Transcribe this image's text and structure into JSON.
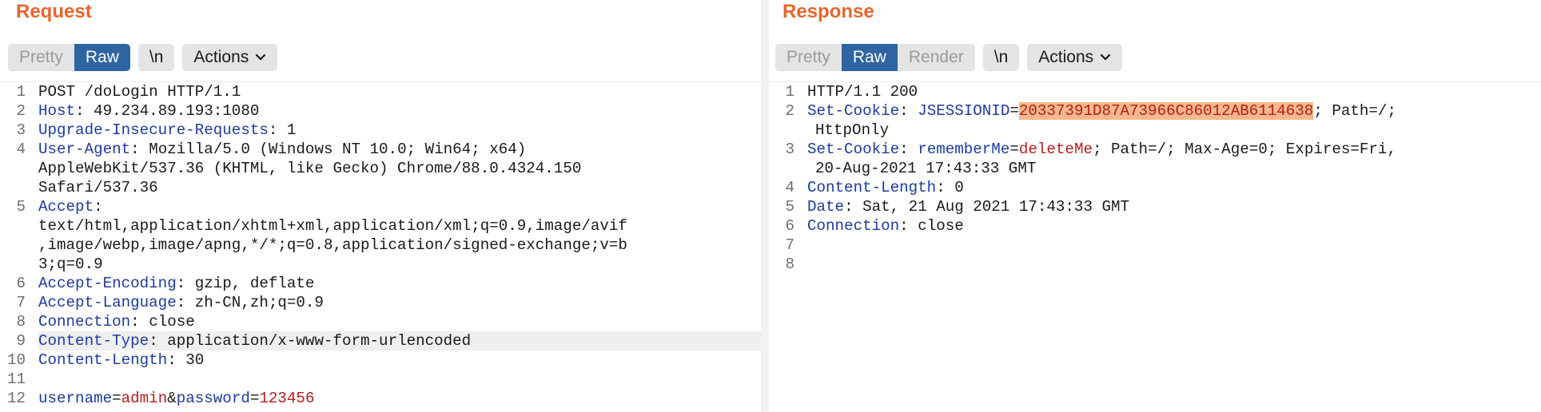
{
  "request": {
    "title": "Request",
    "tabs": [
      {
        "label": "Pretty",
        "active": false
      },
      {
        "label": "Raw",
        "active": true
      }
    ],
    "newline_label": "\\n",
    "actions_label": "Actions",
    "lines": [
      {
        "n": "1",
        "text": "POST /doLogin HTTP/1.1"
      },
      {
        "n": "2",
        "name": "Host",
        "value": "49.234.89.193:1080"
      },
      {
        "n": "3",
        "name": "Upgrade-Insecure-Requests",
        "value": "1"
      },
      {
        "n": "4",
        "name": "User-Agent",
        "value": "Mozilla/5.0 (Windows NT 10.0; Win64; x64)",
        "cont": [
          "AppleWebKit/537.36 (KHTML, like Gecko) Chrome/88.0.4324.150",
          "Safari/537.36"
        ]
      },
      {
        "n": "5",
        "name": "Accept",
        "value": "",
        "cont": [
          "text/html,application/xhtml+xml,application/xml;q=0.9,image/avif",
          ",image/webp,image/apng,*/*;q=0.8,application/signed-exchange;v=b",
          "3;q=0.9"
        ]
      },
      {
        "n": "6",
        "name": "Accept-Encoding",
        "value": "gzip, deflate"
      },
      {
        "n": "7",
        "name": "Accept-Language",
        "value": "zh-CN,zh;q=0.9"
      },
      {
        "n": "8",
        "name": "Connection",
        "value": "close"
      },
      {
        "n": "9",
        "name": "Content-Type",
        "value": "application/x-www-form-urlencoded"
      },
      {
        "n": "10",
        "name": "Content-Length",
        "value": "30"
      },
      {
        "n": "11",
        "text": ""
      },
      {
        "n": "12",
        "params": [
          {
            "k": "username",
            "v": "admin"
          },
          {
            "k": "password",
            "v": "123456"
          }
        ]
      }
    ]
  },
  "response": {
    "title": "Response",
    "tabs": [
      {
        "label": "Pretty",
        "active": false
      },
      {
        "label": "Raw",
        "active": true
      },
      {
        "label": "Render",
        "active": false
      }
    ],
    "newline_label": "\\n",
    "actions_label": "Actions",
    "line_numbers": [
      "1",
      "2",
      "3",
      "4",
      "5",
      "6",
      "7",
      "8"
    ],
    "status_line": "HTTP/1.1 200",
    "set_cookie_1": {
      "name": "Set-Cookie",
      "cookie_name": "JSESSIONID",
      "cookie_value": "20337391D87A73966C86012AB6114638",
      "rest": "; Path=/;",
      "cont": "HttpOnly"
    },
    "set_cookie_2": {
      "name": "Set-Cookie",
      "cookie_name": "rememberMe",
      "cookie_value": "deleteMe",
      "rest": "; Path=/; Max-Age=0; Expires=Fri,",
      "cont": "20-Aug-2021 17:43:33 GMT"
    },
    "content_length": {
      "name": "Content-Length",
      "value": "0"
    },
    "date": {
      "name": "Date",
      "value": "Sat, 21 Aug 2021 17:43:33 GMT"
    },
    "connection": {
      "name": "Connection",
      "value": "close"
    }
  },
  "colors": {
    "accent": "#e8652d",
    "active_tab": "#2e64a1",
    "header_name": "#1e3a9e",
    "param_value": "#b51d1d",
    "cookie_highlight": "#f6b88a"
  }
}
